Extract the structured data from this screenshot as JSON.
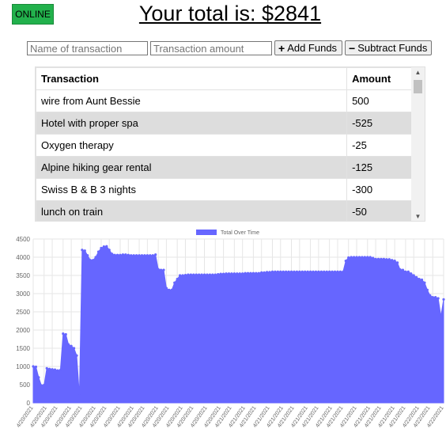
{
  "status": {
    "label": "ONLINE",
    "color": "#22b14c"
  },
  "header": {
    "prefix": "Your total is:",
    "amount": "$2841"
  },
  "form": {
    "name_placeholder": "Name of transaction",
    "amount_placeholder": "Transaction amount",
    "add_label": "Add Funds",
    "subtract_label": "Subtract Funds",
    "add_icon": "plus-icon",
    "subtract_icon": "minus-icon"
  },
  "table": {
    "headers": [
      "Transaction",
      "Amount"
    ],
    "rows": [
      {
        "name": "wire from Aunt Bessie",
        "amount": "500"
      },
      {
        "name": "Hotel with proper spa",
        "amount": "-525"
      },
      {
        "name": "Oxygen therapy",
        "amount": "-25"
      },
      {
        "name": "Alpine hiking gear rental",
        "amount": "-125"
      },
      {
        "name": "Swiss B & B 3 nights",
        "amount": "-300"
      },
      {
        "name": "lunch on train",
        "amount": "-50"
      }
    ]
  },
  "chart_data": {
    "type": "area",
    "legend": "Total Over Time",
    "legend_position": "top-center",
    "fill_color": "#6666ff",
    "grid": true,
    "ylim": [
      0,
      4500
    ],
    "yticks": [
      0,
      500,
      1000,
      1500,
      2000,
      2500,
      3000,
      3500,
      4000,
      4500
    ],
    "x": [
      "4/20/2021",
      "4/20/2021",
      "4/20/2021",
      "4/20/2021",
      "4/20/2021",
      "4/20/2021",
      "4/20/2021",
      "4/20/2021",
      "4/20/2021",
      "4/20/2021",
      "4/20/2021",
      "4/20/2021",
      "4/20/2021",
      "4/20/2021",
      "4/20/2021",
      "4/20/2021",
      "4/20/2021",
      "4/20/2021",
      "4/20/2021",
      "4/20/2021",
      "4/20/2021",
      "4/20/2021",
      "4/20/2021",
      "4/20/2021",
      "4/20/2021",
      "4/20/2021",
      "4/20/2021",
      "4/20/2021",
      "4/20/2021",
      "4/20/2021",
      "4/20/2021",
      "4/20/2021",
      "4/20/2021",
      "4/20/2021",
      "4/20/2021",
      "4/20/2021",
      "4/20/2021",
      "4/20/2021",
      "4/20/2021",
      "4/20/2021",
      "4/20/2021",
      "4/20/2021",
      "4/20/2021",
      "4/20/2021",
      "4/20/2021",
      "4/20/2021",
      "4/20/2021",
      "4/20/2021",
      "4/20/2021",
      "4/20/2021",
      "4/20/2021",
      "4/20/2021",
      "4/20/2021",
      "4/20/2021",
      "4/20/2021",
      "4/20/2021",
      "4/20/2021",
      "4/20/2021",
      "4/20/2021",
      "4/20/2021",
      "4/20/2021",
      "4/20/2021",
      "4/20/2021",
      "4/20/2021",
      "4/20/2021",
      "4/20/2021",
      "4/20/2021",
      "4/20/2021",
      "4/20/2021",
      "4/20/2021",
      "4/20/2021",
      "4/20/2021",
      "4/20/2021",
      "4/21/2021",
      "4/21/2021",
      "4/21/2021",
      "4/21/2021",
      "4/21/2021",
      "4/21/2021",
      "4/21/2021",
      "4/21/2021",
      "4/21/2021",
      "4/21/2021",
      "4/21/2021",
      "4/21/2021",
      "4/21/2021",
      "4/21/2021",
      "4/21/2021",
      "4/21/2021",
      "4/21/2021",
      "4/21/2021",
      "4/21/2021",
      "4/21/2021",
      "4/21/2021",
      "4/21/2021",
      "4/21/2021",
      "4/21/2021",
      "4/21/2021",
      "4/21/2021",
      "4/21/2021",
      "4/21/2021",
      "4/21/2021",
      "4/21/2021",
      "4/21/2021",
      "4/21/2021",
      "4/21/2021",
      "4/21/2021",
      "4/21/2021",
      "4/21/2021",
      "4/21/2021",
      "4/21/2021",
      "4/21/2021",
      "4/21/2021",
      "4/21/2021",
      "4/21/2021",
      "4/21/2021",
      "4/21/2021",
      "4/21/2021",
      "4/21/2021",
      "4/21/2021",
      "4/21/2021",
      "4/21/2021",
      "4/21/2021",
      "4/21/2021",
      "4/21/2021",
      "4/21/2021",
      "4/21/2021",
      "4/21/2021",
      "4/21/2021",
      "4/21/2021",
      "4/21/2021",
      "4/21/2021",
      "4/21/2021",
      "4/21/2021",
      "4/21/2021",
      "4/21/2021",
      "4/21/2021",
      "4/21/2021",
      "4/21/2021",
      "4/22/2021",
      "4/22/2021",
      "4/22/2021",
      "4/22/2021",
      "4/22/2021",
      "4/22/2021",
      "4/22/2021",
      "4/22/2021",
      "4/22/2021",
      "4/22/2021",
      "4/22/2021",
      "4/22/2021",
      "4/22/2021",
      "4/22/2021",
      "4/22/2021",
      "4/22/2021",
      "4/22/2021",
      "4/22/2021",
      "4/22/2021",
      "4/22/2021",
      "4/22/2021",
      "4/22/2021",
      "4/22/2021",
      "4/22/2021",
      "4/22/2021",
      "4/22/2021",
      "4/22/2021",
      "4/22/2021",
      "4/22/2021",
      "4/22/2021",
      "4/22/2021",
      "4/22/2021",
      "4/22/2021",
      "4/22/2021",
      "4/22/2021",
      "4/22/2021",
      "4/22/2021",
      "4/22/2021",
      "4/22/2021",
      "4/22/2021",
      "4/22/2021"
    ],
    "values": [
      1000,
      990,
      700,
      480,
      490,
      950,
      930,
      920,
      910,
      890,
      900,
      1900,
      1880,
      1600,
      1560,
      1500,
      1300,
      200,
      4200,
      4180,
      4050,
      3920,
      3920,
      4000,
      4150,
      4250,
      4290,
      4300,
      4200,
      4090,
      4060,
      4060,
      4060,
      4070,
      4070,
      4060,
      4050,
      4050,
      4050,
      4050,
      4050,
      4050,
      4050,
      4050,
      4050,
      4070,
      3670,
      3650,
      3650,
      3150,
      3100,
      3100,
      3300,
      3400,
      3500,
      3500,
      3510,
      3520,
      3520,
      3520,
      3520,
      3520,
      3520,
      3520,
      3520,
      3520,
      3520,
      3520,
      3530,
      3540,
      3540,
      3550,
      3550,
      3550,
      3550,
      3550,
      3550,
      3550,
      3560,
      3560,
      3560,
      3560,
      3560,
      3560,
      3580,
      3580,
      3590,
      3590,
      3600,
      3600,
      3600,
      3600,
      3600,
      3600,
      3600,
      3600,
      3600,
      3600,
      3600,
      3600,
      3600,
      3600,
      3600,
      3600,
      3600,
      3600,
      3600,
      3600,
      3600,
      3600,
      3600,
      3600,
      3600,
      3600,
      3600,
      3900,
      3990,
      4000,
      4000,
      4000,
      4000,
      4000,
      4000,
      4000,
      4000,
      3980,
      3950,
      3950,
      3950,
      3950,
      3940,
      3940,
      3920,
      3900,
      3850,
      3660,
      3650,
      3600,
      3600,
      3550,
      3500,
      3450,
      3400,
      3380,
      3300,
      3100,
      2950,
      2900,
      2900,
      2870,
      2380,
      2841
    ]
  }
}
